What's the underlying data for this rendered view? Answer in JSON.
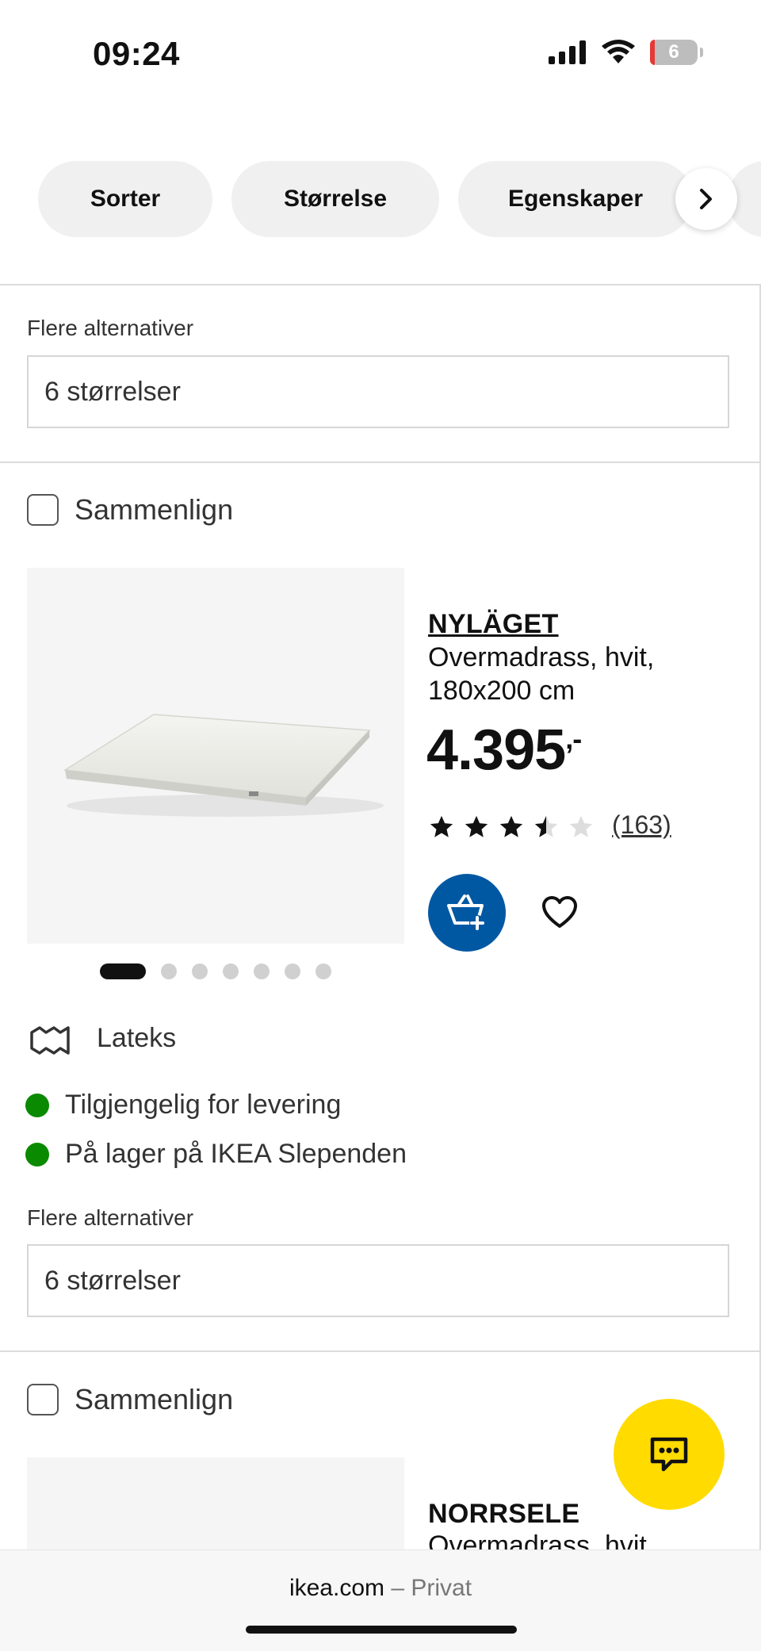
{
  "status_bar": {
    "time": "09:24",
    "battery": "6"
  },
  "filters": {
    "chips": [
      "Sorter",
      "Størrelse",
      "Egenskaper"
    ],
    "next_icon": "chevron-right-icon"
  },
  "section1": {
    "options_label": "Flere alternativer",
    "sizes": "6 størrelser"
  },
  "product1": {
    "compare_label": "Sammenlign",
    "name": "NYLÄGET",
    "desc_line1": "Overmadrass, hvit,",
    "desc_line2": "180x200 cm",
    "price": "4.395",
    "price_suffix": ",-",
    "rating": 3.5,
    "rating_max": 5,
    "reviews": "(163)",
    "image_dots": 7,
    "active_dot": 0,
    "feature": "Lateks",
    "availability": [
      "Tilgjengelig for levering",
      "På lager på IKEA Slependen"
    ],
    "options_label": "Flere alternativer",
    "sizes": "6 størrelser"
  },
  "product2": {
    "compare_label": "Sammenlign",
    "name": "NORRSELE",
    "desc": "Overmadrass, hvit,"
  },
  "browser": {
    "domain": "ikea.com",
    "separator": " – ",
    "mode": "Privat"
  },
  "colors": {
    "accent_blue": "#0058a3",
    "chat_yellow": "#ffdb00",
    "available_green": "#0a8a00"
  }
}
